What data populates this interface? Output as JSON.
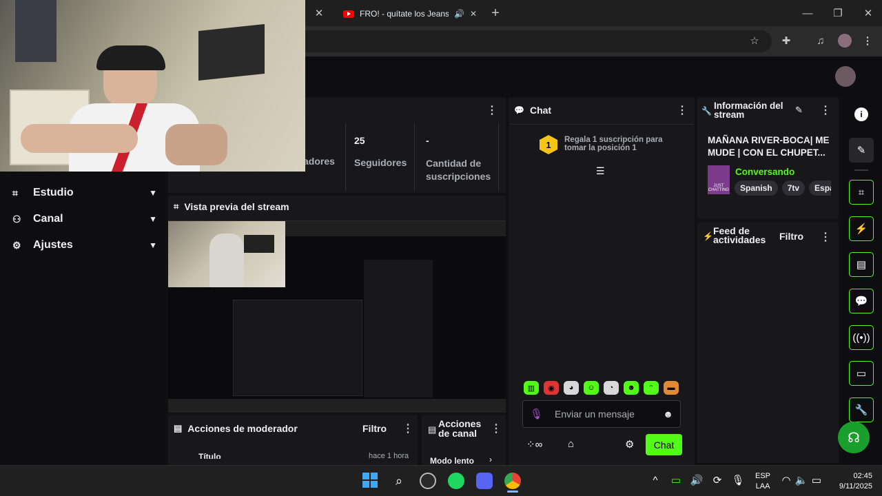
{
  "browser": {
    "tab_title": "FRO! - quítate los Jeans (Vic",
    "new_tab_label": "+"
  },
  "sidebar": {
    "items": [
      {
        "label": "Estudio"
      },
      {
        "label": "Canal"
      },
      {
        "label": "Ajustes"
      }
    ]
  },
  "stats": {
    "col1_label": "adores",
    "col2_value": "25",
    "col2_label": "Seguidores",
    "col3_value": "-",
    "col3_label": "Cantidad de suscripciones"
  },
  "preview": {
    "title": "Vista previa del stream"
  },
  "moderator": {
    "title": "Acciones de moderador",
    "filter_label": "Filtro",
    "row_label": "Título",
    "row_time": "hace 1 hora"
  },
  "channel_actions": {
    "title": "Acciones de canal",
    "item_label": "Modo lento"
  },
  "chat": {
    "title": "Chat",
    "gift_text": "Regala 1 suscripción para tomar la posición 1",
    "gift_rank": "1",
    "input_placeholder": "Enviar un mensaje",
    "send_label": "Chat"
  },
  "stream_info": {
    "title": "Información del stream",
    "stream_title": "MAÑANA RIVER-BOCA| ME MUDE | CON EL CHUPET...",
    "category": "Conversando",
    "thumb_text": "JUST CHATTING",
    "tags": [
      "Spanish",
      "7tv",
      "Espa"
    ]
  },
  "activity_feed": {
    "title": "Feed de actividades",
    "filter_label": "Filtro"
  },
  "taskbar": {
    "lang_line1": "ESP",
    "lang_line2": "LAA",
    "time": "02:45",
    "date": "9/11/2025"
  },
  "colors": {
    "accent": "#53fc18",
    "panel": "#18181b",
    "background": "#0e0e10"
  }
}
